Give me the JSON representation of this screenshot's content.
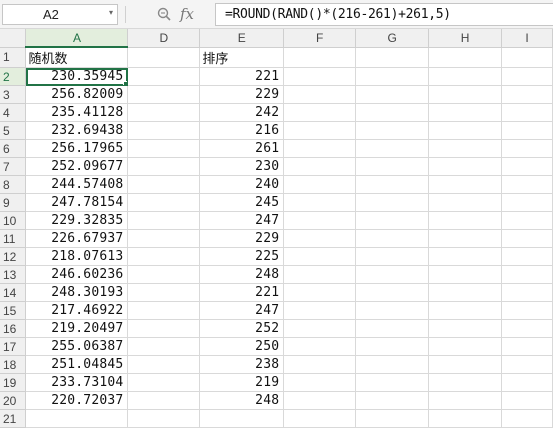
{
  "formula_bar": {
    "name_box": "A2",
    "name_box_dropdown": "▾",
    "fx_label": "fx",
    "formula": "=ROUND(RAND()*(216-261)+261,5)"
  },
  "columns": [
    "A",
    "D",
    "E",
    "F",
    "G",
    "H",
    "I"
  ],
  "rows": [
    {
      "n": "1",
      "a": "随机数",
      "e": "排序"
    },
    {
      "n": "2",
      "a": "230.35945",
      "e": "221"
    },
    {
      "n": "3",
      "a": "256.82009",
      "e": "229"
    },
    {
      "n": "4",
      "a": "235.41128",
      "e": "242"
    },
    {
      "n": "5",
      "a": "232.69438",
      "e": "216"
    },
    {
      "n": "6",
      "a": "256.17965",
      "e": "261"
    },
    {
      "n": "7",
      "a": "252.09677",
      "e": "230"
    },
    {
      "n": "8",
      "a": "244.57408",
      "e": "240"
    },
    {
      "n": "9",
      "a": "247.78154",
      "e": "245"
    },
    {
      "n": "10",
      "a": "229.32835",
      "e": "247"
    },
    {
      "n": "11",
      "a": "226.67937",
      "e": "229"
    },
    {
      "n": "12",
      "a": "218.07613",
      "e": "225"
    },
    {
      "n": "13",
      "a": "246.60236",
      "e": "248"
    },
    {
      "n": "14",
      "a": "248.30193",
      "e": "221"
    },
    {
      "n": "15",
      "a": "217.46922",
      "e": "247"
    },
    {
      "n": "16",
      "a": "219.20497",
      "e": "252"
    },
    {
      "n": "17",
      "a": "255.06387",
      "e": "250"
    },
    {
      "n": "18",
      "a": "251.04845",
      "e": "238"
    },
    {
      "n": "19",
      "a": "233.73104",
      "e": "219"
    },
    {
      "n": "20",
      "a": "220.72037",
      "e": "248"
    },
    {
      "n": "21",
      "a": "",
      "e": ""
    }
  ],
  "active_cell": "A2",
  "colors": {
    "selection": "#217346",
    "selected_header_bg": "#e3eedd"
  }
}
